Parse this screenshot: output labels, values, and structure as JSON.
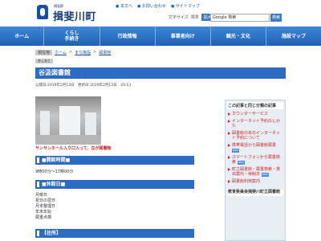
{
  "header": {
    "town_small": "揖斐郡",
    "town_name": "揖斐川町",
    "links": [
      "本文へ",
      "お問い合わせ",
      "サイトマップ"
    ],
    "text_size_label": "文字サイズ",
    "standard_label": "標準",
    "enlarge_label": "拡大",
    "search_placeholder": "Google 検索",
    "search_button": "検索"
  },
  "nav": [
    "ホーム",
    "くらし\n手続き",
    "行政情報",
    "事業者向け",
    "観光・文化",
    "施設マップ"
  ],
  "breadcrumb": {
    "current": "現在地",
    "home": "ホーム",
    "sep": ">",
    "cat": "まな施設",
    "item": "図書館"
  },
  "breadcrumb2": "あしあと",
  "page": {
    "title": "谷汲図書館",
    "date": "公開日:2019年2月13日　更新日:2019年2月13日　20:13",
    "caption": "サンサンホール入り口入って、左が図書館"
  },
  "sections": [
    {
      "heading": "■開館時間■",
      "lines": [
        "9時00分～17時00分"
      ]
    },
    {
      "heading": "■休館日■",
      "lines": [
        "月曜日",
        "祝日の翌日",
        "月末整理日",
        "年末年始",
        "蔵書点検"
      ]
    },
    {
      "heading": "【住所】",
      "lines": []
    }
  ],
  "sidebar": {
    "heading": "この記事と同じ分類の記事",
    "items": [
      {
        "text": "カウンターサービス",
        "new": ""
      },
      {
        "text": "インターネット予約のしかた",
        "new": ""
      },
      {
        "text": "図書館の本のインターネット予約について",
        "new": ""
      },
      {
        "text": "携帯電話から図書館蔵書",
        "new": "NEW"
      },
      {
        "text": "スマートフォンから蔵書検索",
        "new": "NEW"
      },
      {
        "text": "町立図書館・蔵書検索・貸出案内・休館日",
        "new": "NEW"
      },
      {
        "text": "図書館利用案内",
        "new": ""
      }
    ],
    "footer_heading": "教育委員会揖斐川町立図書館"
  }
}
